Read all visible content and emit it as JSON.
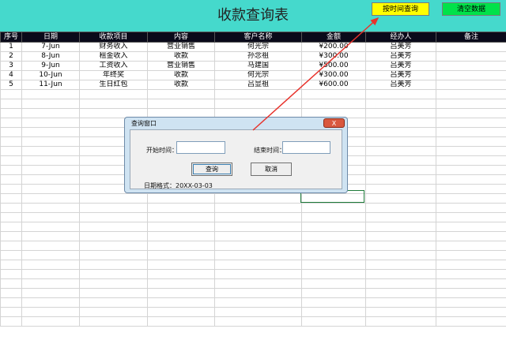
{
  "sheet": {
    "title": "收款查询表",
    "buttons": {
      "query_by_time": "按时间查询",
      "clear_data": "清空数据"
    },
    "headers": [
      "序号",
      "日期",
      "收款项目",
      "内容",
      "客户名称",
      "金额",
      "经办人",
      "备注"
    ],
    "rows": [
      [
        "1",
        "7-Jun",
        "财务收入",
        "营业销售",
        "何光宗",
        "¥200.00",
        "吕美芳",
        ""
      ],
      [
        "2",
        "8-Jun",
        "租金收入",
        "收款",
        "孙念祖",
        "¥300.00",
        "吕美芳",
        ""
      ],
      [
        "3",
        "9-Jun",
        "工资收入",
        "营业销售",
        "马建国",
        "¥500.00",
        "吕美芳",
        ""
      ],
      [
        "4",
        "10-Jun",
        "年终奖",
        "收款",
        "何光宗",
        "¥300.00",
        "吕美芳",
        ""
      ],
      [
        "5",
        "11-Jun",
        "生日红包",
        "收款",
        "吕显祖",
        "¥600.00",
        "吕美芳",
        ""
      ]
    ]
  },
  "dialog": {
    "title": "查询窗口",
    "close_label": "X",
    "start_label": "开始时间：",
    "start_value": "",
    "end_label": "结束时间：",
    "end_value": "",
    "query_button": "查询",
    "cancel_button": "取消",
    "format_hint": "日期格式：20XX-03-03"
  },
  "colors": {
    "title_band": "#45d9cc",
    "header_bg": "#0a0a1a",
    "query_button": "#ffff00",
    "clear_button": "#00e24a",
    "annotation_arrow": "#e8322b"
  }
}
